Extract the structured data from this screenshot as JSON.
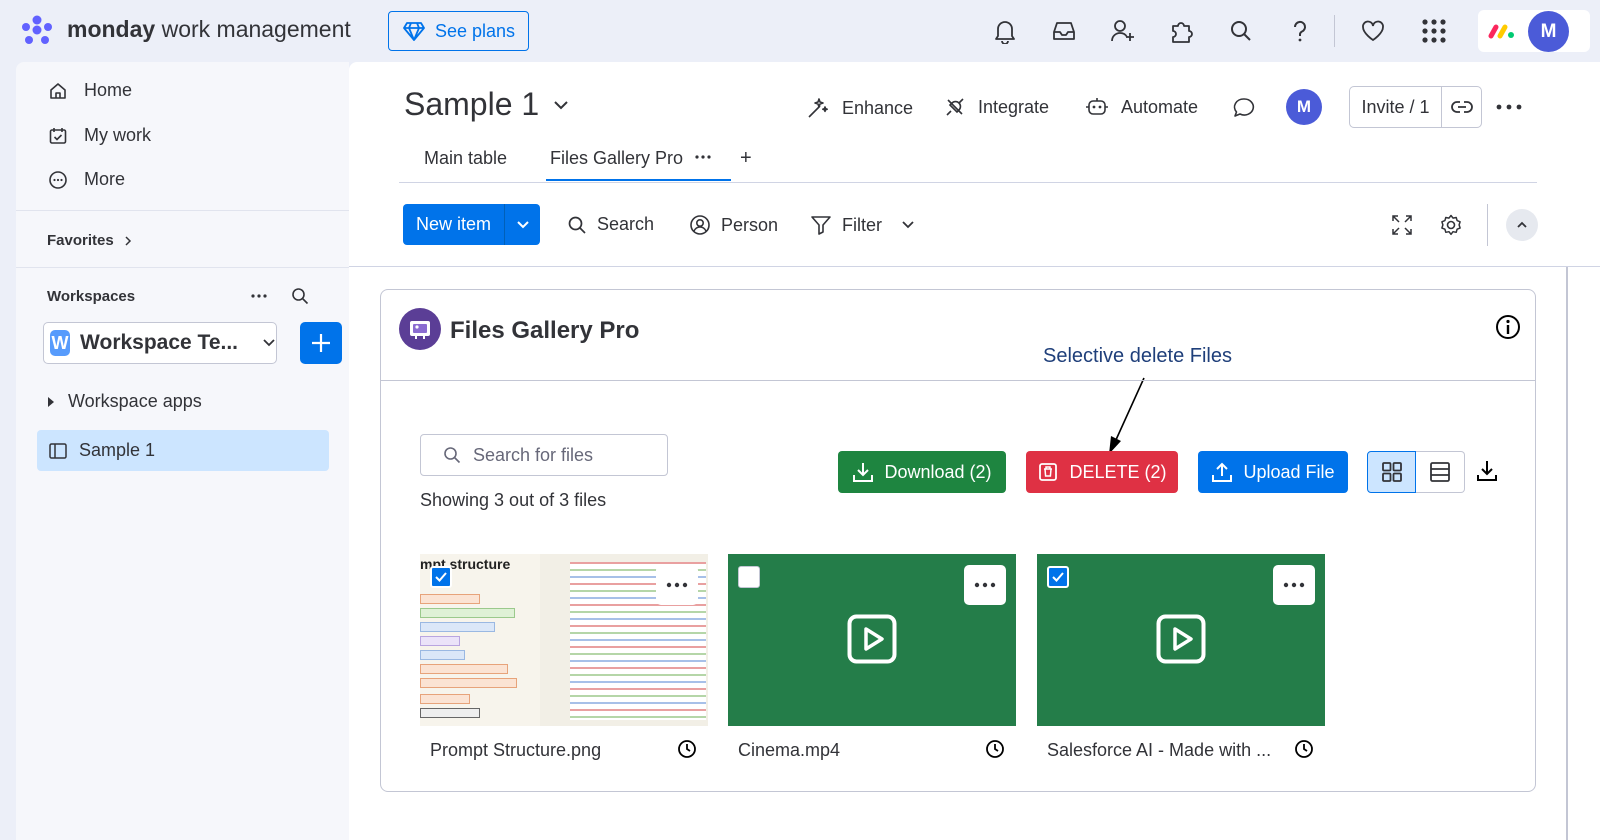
{
  "app": {
    "brand_bold": "monday",
    "brand_rest": " work management",
    "see_plans": "See plans",
    "avatar_letter": "M"
  },
  "sidebar": {
    "nav": [
      {
        "label": "Home",
        "icon": "home-icon"
      },
      {
        "label": "My work",
        "icon": "calendar-check-icon"
      },
      {
        "label": "More",
        "icon": "more-circle-icon"
      }
    ],
    "favorites": "Favorites",
    "workspaces": "Workspaces",
    "workspace_badge": "W",
    "workspace_name": "Workspace Te...",
    "workspace_apps": "Workspace apps",
    "board": "Sample 1"
  },
  "board": {
    "title": "Sample 1",
    "enhance": "Enhance",
    "integrate": "Integrate",
    "automate": "Automate",
    "avatar_letter": "M",
    "invite": "Invite / 1",
    "tabs": [
      "Main table",
      "Files Gallery Pro"
    ],
    "add_tab": "+"
  },
  "toolbar": {
    "new_item": "New item",
    "search": "Search",
    "person": "Person",
    "filter": "Filter"
  },
  "widget": {
    "title": "Files Gallery Pro",
    "annotation": "Selective delete Files",
    "search_placeholder": "Search for files",
    "showing": "Showing 3 out of 3 files",
    "download": "Download (2)",
    "delete": "DELETE (2)",
    "upload": "Upload File",
    "colors": {
      "download": "#1e8540",
      "delete": "#df3144",
      "upload": "#0073ea"
    },
    "files": [
      {
        "name": "Prompt Structure.png",
        "checked": true,
        "type": "image",
        "thumb_heading": "mpt structure"
      },
      {
        "name": "Cinema.mp4",
        "checked": false,
        "type": "video"
      },
      {
        "name": "Salesforce AI - Made with ...",
        "checked": true,
        "type": "video"
      }
    ]
  }
}
